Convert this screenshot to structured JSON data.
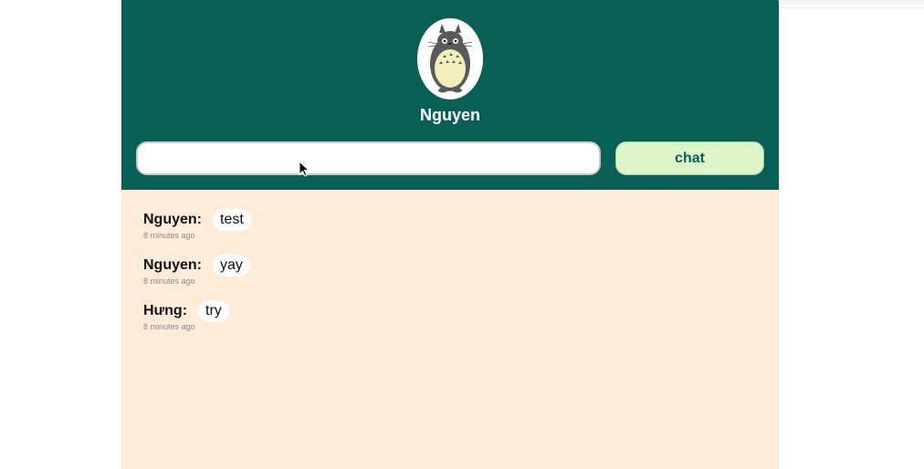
{
  "profile": {
    "name": "Nguyen",
    "avatar_icon": "totoro-avatar-icon"
  },
  "composer": {
    "input_value": "",
    "input_placeholder": "",
    "send_label": "chat"
  },
  "messages": [
    {
      "sender": "Nguyen:",
      "text": "test",
      "time": "8 minutes ago"
    },
    {
      "sender": "Nguyen:",
      "text": "yay",
      "time": "8 minutes ago"
    },
    {
      "sender": "Hưng:",
      "text": "try",
      "time": "8 minutes ago"
    }
  ],
  "colors": {
    "header": "#085f56",
    "background": "#feebd8",
    "button": "#ddf5c9",
    "button_text": "#085f56"
  }
}
